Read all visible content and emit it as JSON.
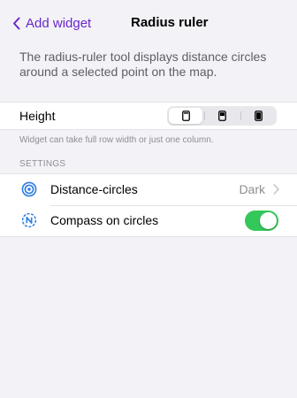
{
  "nav": {
    "back_label": "Add widget",
    "title": "Radius ruler"
  },
  "description": "The radius-ruler tool displays distance circles around a selected point on the map.",
  "height": {
    "label": "Height",
    "options": [
      "small-widget-icon",
      "medium-widget-icon",
      "large-widget-icon"
    ],
    "selected_index": 0,
    "hint": "Widget can take full row width or just one column."
  },
  "settings": {
    "section_title": "SETTINGS",
    "items": [
      {
        "icon": "distance-circles-icon",
        "label": "Distance-circles",
        "value": "Dark"
      },
      {
        "icon": "compass-icon",
        "label": "Compass on circles",
        "toggle_on": true
      }
    ]
  },
  "colors": {
    "accent": "#6a27c9",
    "toggle_on": "#34c759",
    "background": "#f2f2f7"
  }
}
